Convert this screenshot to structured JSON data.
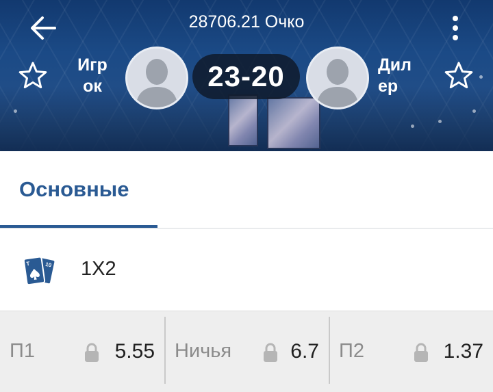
{
  "header": {
    "match_title": "28706.21 Очко",
    "score": "23-20",
    "team_left": {
      "name_line1": "Игр",
      "name_line2": "ок"
    },
    "team_right": {
      "name_line1": "Дил",
      "name_line2": "ер"
    }
  },
  "icons": {
    "back": "back-arrow-icon",
    "menu": "more-vertical-icon",
    "favorite": "star-outline-icon",
    "avatar": "user-avatar-icon",
    "market": "playing-cards-icon",
    "lock": "lock-icon"
  },
  "tabs": [
    {
      "label": "Основные",
      "active": true
    }
  ],
  "market": {
    "name": "1X2",
    "outcomes": [
      {
        "label": "П1",
        "odds": "5.55",
        "locked": true
      },
      {
        "label": "Ничья",
        "odds": "6.7",
        "locked": true
      },
      {
        "label": "П2",
        "odds": "1.37",
        "locked": true
      }
    ]
  },
  "colors": {
    "accent": "#2a5a93",
    "header_bg": "#1b4a86",
    "odds_bg": "#eeeeee",
    "muted_text": "#8b8b8b"
  }
}
